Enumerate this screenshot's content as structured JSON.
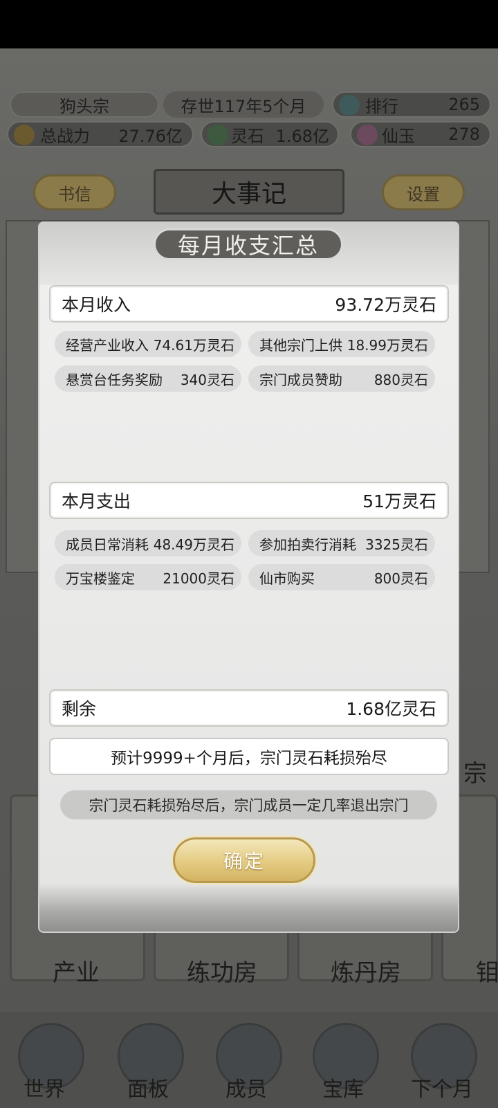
{
  "topbar": {
    "sect_name": "狗头宗",
    "sect_age": "存世117年5个月",
    "rank_label": "排行",
    "rank_value": "265",
    "power_label": "总战力",
    "power_value": "27.76亿",
    "stone_label": "灵石",
    "stone_value": "1.68亿",
    "jade_label": "仙玉",
    "jade_value": "278"
  },
  "header": {
    "letters_button": "书信",
    "events_title": "大事记",
    "settings_button": "设置"
  },
  "facilities": [
    "产业",
    "练功房",
    "炼丹房",
    "钼"
  ],
  "side_label": "宗",
  "nav": [
    "世界",
    "面板",
    "成员",
    "宝库",
    "下个月"
  ],
  "modal": {
    "title": "每月收支汇总",
    "income": {
      "label": "本月收入",
      "total": "93.72万灵石",
      "items": [
        {
          "name": "经营产业收入",
          "value": "74.61万灵石"
        },
        {
          "name": "其他宗门上供",
          "value": "18.99万灵石"
        },
        {
          "name": "悬赏台任务奖励",
          "value": "340灵石"
        },
        {
          "name": "宗门成员赞助",
          "value": "880灵石"
        }
      ]
    },
    "expense": {
      "label": "本月支出",
      "total": "51万灵石",
      "items": [
        {
          "name": "成员日常消耗",
          "value": "48.49万灵石"
        },
        {
          "name": "参加拍卖行消耗",
          "value": "3325灵石"
        },
        {
          "name": "万宝楼鉴定",
          "value": "21000灵石"
        },
        {
          "name": "仙市购买",
          "value": "800灵石"
        }
      ]
    },
    "remaining": {
      "label": "剩余",
      "value": "1.68亿灵石"
    },
    "forecast": "预计9999+个月后，宗门灵石耗损殆尽",
    "warning": "宗门灵石耗损殆尽后，宗门成员一定几率退出宗门",
    "confirm": "确定"
  }
}
